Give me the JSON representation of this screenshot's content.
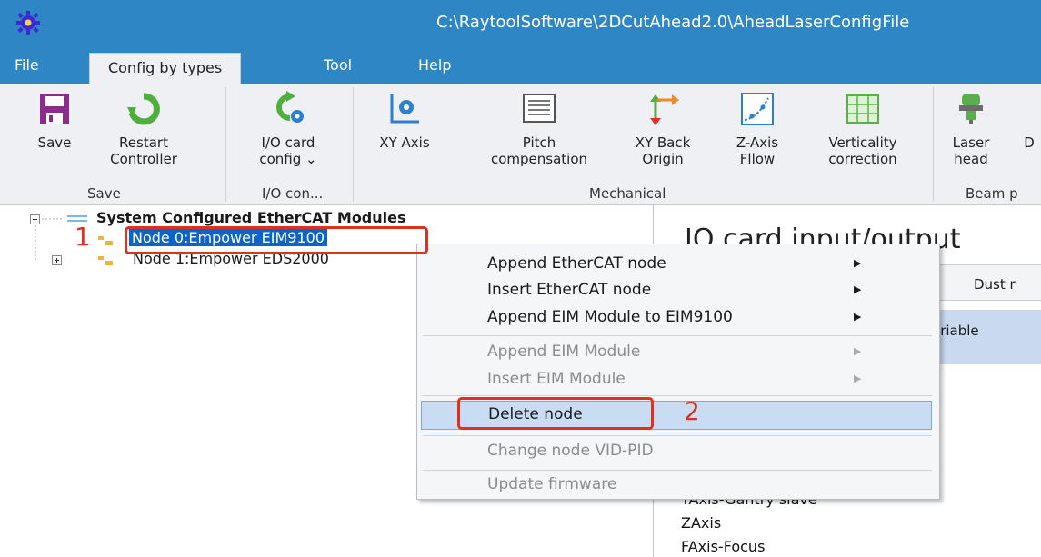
{
  "window": {
    "title": "C:\\RaytoolSoftware\\2DCutAhead2.0\\AheadLaserConfigFile"
  },
  "menu": {
    "items": [
      {
        "label": "File"
      },
      {
        "label": "Config by types",
        "active": true
      },
      {
        "label": "Tool"
      },
      {
        "label": "Help"
      }
    ]
  },
  "ribbon": {
    "buttons": [
      {
        "label": "Save"
      },
      {
        "label": "Restart\nController"
      },
      {
        "label": "I/O card\nconfig ⌄"
      },
      {
        "label": "XY Axis"
      },
      {
        "label": "Pitch\ncompensation"
      },
      {
        "label": "XY Back\nOrigin"
      },
      {
        "label": "Z-Axis\nFllow"
      },
      {
        "label": "Verticality\ncorrection"
      },
      {
        "label": "Laser\nhead"
      },
      {
        "label": "D"
      }
    ],
    "groups": [
      {
        "label": "Save"
      },
      {
        "label": "I/O con..."
      },
      {
        "label": "Mechanical"
      },
      {
        "label": "Beam p"
      }
    ]
  },
  "tree": {
    "root": "System Configured EtherCAT Modules",
    "nodes": [
      {
        "label": "Node 0:Empower EIM9100",
        "selected": true
      },
      {
        "label": "Node 1:Empower EDS2000"
      }
    ]
  },
  "right_panel": {
    "title": "IO card input/output",
    "tab_partial": "Dust r",
    "header_partial": "ariable",
    "rows": [
      "YAxis-Gantry slave",
      "ZAxis",
      "FAxis-Focus"
    ]
  },
  "context_menu": {
    "items": [
      {
        "label": "Append EtherCAT node",
        "submenu": true,
        "enabled": true
      },
      {
        "label": "Insert EtherCAT node",
        "submenu": true,
        "enabled": true
      },
      {
        "label": "Append EIM Module to EIM9100",
        "submenu": true,
        "enabled": true
      },
      {
        "label": "Append EIM Module",
        "submenu": true,
        "enabled": false
      },
      {
        "label": "Insert EIM Module",
        "submenu": true,
        "enabled": false
      },
      {
        "label": "Delete node",
        "submenu": false,
        "enabled": true,
        "highlighted": true
      },
      {
        "label": "Change node VID-PID",
        "submenu": false,
        "enabled": false
      },
      {
        "label": "Update firmware",
        "submenu": false,
        "enabled": false
      }
    ],
    "submenu_arrow": "▶"
  },
  "annotations": {
    "step1": "1",
    "step2": "2"
  },
  "colors": {
    "titlebar": "#2f86c4",
    "ribbon_bg": "#eef0f3",
    "selection": "#0a64c9",
    "menu_hover": "#c8ddf4",
    "annotation_red": "#e0301e"
  }
}
